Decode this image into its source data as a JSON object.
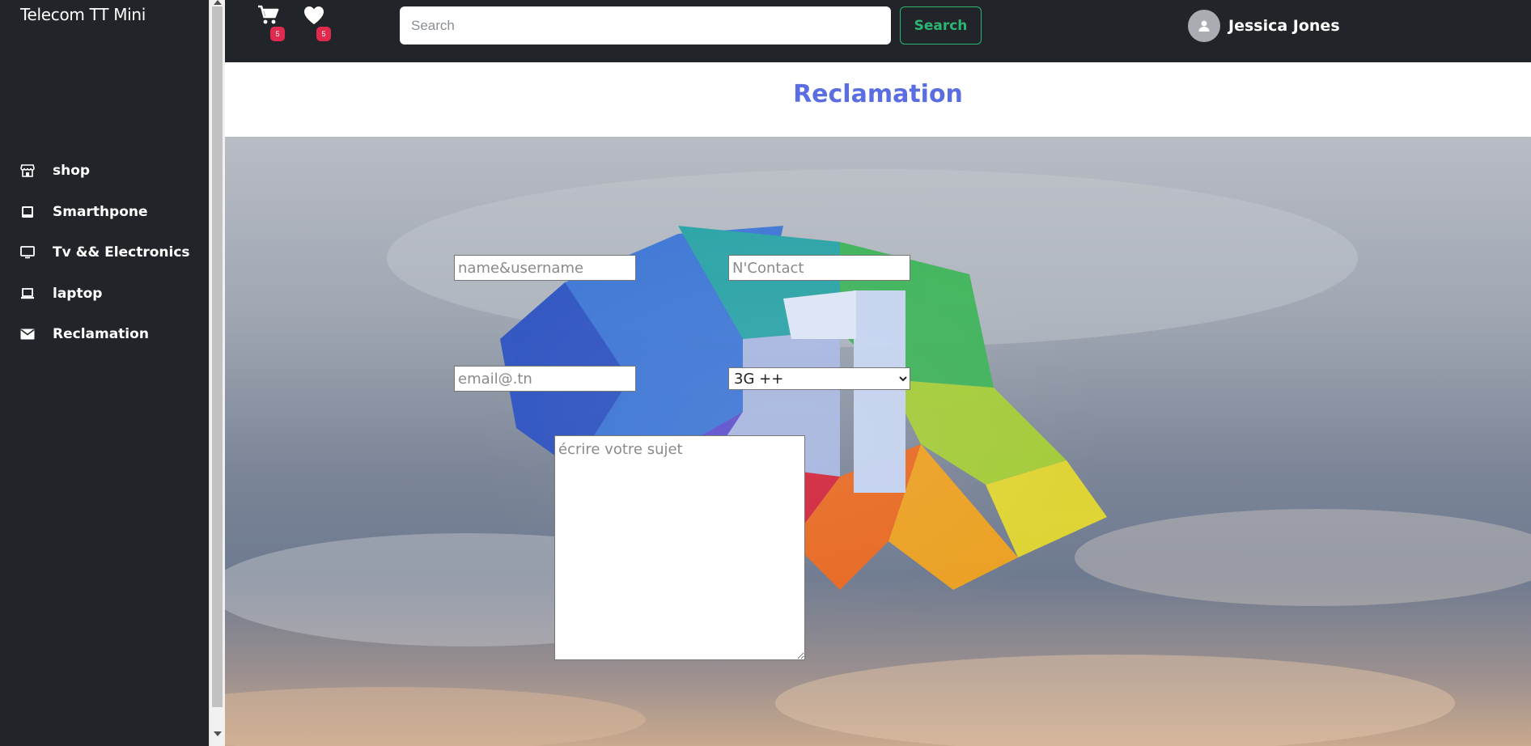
{
  "sidebar": {
    "brand": "Telecom TT Mini",
    "items": [
      {
        "label": "shop",
        "icon": "store-icon"
      },
      {
        "label": "Smarthpone",
        "icon": "tablet-icon"
      },
      {
        "label": "Tv && Electronics",
        "icon": "monitor-icon"
      },
      {
        "label": "laptop",
        "icon": "laptop-icon"
      },
      {
        "label": "Reclamation",
        "icon": "envelope-icon"
      }
    ]
  },
  "topbar": {
    "cart": {
      "icon": "cart-icon",
      "count": "5"
    },
    "wishlist": {
      "icon": "heart-icon",
      "count": "5"
    },
    "search_placeholder": "Search",
    "search_button": "Search",
    "user_name": "Jessica Jones",
    "avatar_icon": "user-icon"
  },
  "page": {
    "title": "Reclamation"
  },
  "form": {
    "name_placeholder": "name&username",
    "contact_placeholder": "N'Contact",
    "email_placeholder": "email@.tn",
    "service_selected": "3G ++",
    "subject_placeholder": "écrire votre sujet"
  },
  "colors": {
    "sidebar_bg": "#212529",
    "title_color": "#5b6ee1",
    "search_button_color": "#2bb673",
    "badge_color": "#e0294f"
  }
}
